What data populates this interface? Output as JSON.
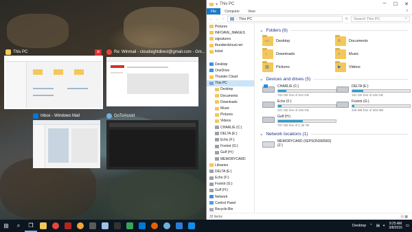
{
  "task_view": {
    "windows": [
      {
        "title": "This PC",
        "selected": true
      },
      {
        "title": "Re: Winmail - cloudsightdirect@gmail.com - Gm..."
      },
      {
        "title": "Inbox - Windows Mail"
      },
      {
        "title": "GoToAssist"
      }
    ]
  },
  "explorer": {
    "title": "This PC",
    "ribbon": {
      "file": "File",
      "tabs": [
        "Computer",
        "View"
      ]
    },
    "address": {
      "path": "This PC",
      "search_placeholder": "Search This PC"
    },
    "nav": [
      {
        "label": "Pictures",
        "type": "folder"
      },
      {
        "label": "INFOAVE_IMAGES",
        "type": "folder"
      },
      {
        "label": "signatures",
        "type": "folder"
      },
      {
        "label": "thunderdcloud.net",
        "type": "folder"
      },
      {
        "label": "ticket",
        "type": "folder"
      },
      {
        "label": "",
        "type": "gap"
      },
      {
        "label": "Desktop",
        "type": "desktop"
      },
      {
        "label": "OneDrive",
        "type": "cloud"
      },
      {
        "label": "Thunder Cloud",
        "type": "folder"
      },
      {
        "label": "This PC",
        "type": "pc",
        "selected": true
      },
      {
        "label": "Desktop",
        "type": "folder",
        "indent": true
      },
      {
        "label": "Documents",
        "type": "folder",
        "indent": true
      },
      {
        "label": "Downloads",
        "type": "folder",
        "indent": true
      },
      {
        "label": "Music",
        "type": "folder",
        "indent": true
      },
      {
        "label": "Pictures",
        "type": "folder",
        "indent": true
      },
      {
        "label": "Videos",
        "type": "folder",
        "indent": true
      },
      {
        "label": "CHARLIE (C:)",
        "type": "drive",
        "indent": true
      },
      {
        "label": "DELTA (E:)",
        "type": "drive",
        "indent": true
      },
      {
        "label": "Echo (F:)",
        "type": "drive",
        "indent": true
      },
      {
        "label": "Foxtrot (G:)",
        "type": "drive",
        "indent": true
      },
      {
        "label": "Gulf (H:)",
        "type": "drive",
        "indent": true
      },
      {
        "label": "MEMORYCARD",
        "type": "drive",
        "indent": true
      },
      {
        "label": "Libraries",
        "type": "folder"
      },
      {
        "label": "DELTA (E:)",
        "type": "drive"
      },
      {
        "label": "Echo (F:)",
        "type": "drive"
      },
      {
        "label": "Foxtrot (G:)",
        "type": "drive"
      },
      {
        "label": "Gulf (H:)",
        "type": "drive"
      },
      {
        "label": "Network",
        "type": "network"
      },
      {
        "label": "Control Panel",
        "type": "cp"
      },
      {
        "label": "Recycle Bin",
        "type": "bin"
      }
    ],
    "folders_header": "Folders (6)",
    "folders": [
      {
        "label": "Desktop",
        "glyph": "▭"
      },
      {
        "label": "Documents",
        "glyph": "≡"
      },
      {
        "label": "Downloads",
        "glyph": "↓"
      },
      {
        "label": "Music",
        "glyph": "♪"
      },
      {
        "label": "Pictures",
        "glyph": "▨"
      },
      {
        "label": "Videos",
        "glyph": "▶"
      }
    ],
    "drives_header": "Devices and drives (5)",
    "drives": [
      {
        "label": "CHARLIE (C:)",
        "free": "783 GB free of 910 GB",
        "used_fraction": 0.14,
        "windows": true
      },
      {
        "label": "DELTA (E:)",
        "free": "191 GB free of 236 GB",
        "used_fraction": 0.19
      },
      {
        "label": "Echo (F:)",
        "free": "221 GB free of 236 GB",
        "used_fraction": 0.06
      },
      {
        "label": "Foxtrot (G:)",
        "free": "348 MB free of 363 MB",
        "used_fraction": 0.04
      },
      {
        "label": "Gulf (H:)",
        "free": "767 GB free of 1.35 TB",
        "used_fraction": 0.43
      }
    ],
    "network_header": "Network locations (1)",
    "network": [
      {
        "label": "MEMORYCARD (\\\\EPSON360583)",
        "sub": "(Z:)"
      }
    ],
    "status": "32 items"
  },
  "taskbar": {
    "desktop_label": "Desktop",
    "time": "9:25 AM",
    "date": "3/8/2016"
  },
  "colors": {
    "accent": "#1979ca",
    "taskbar": "#0c1620",
    "drive_bar": "#26a0da",
    "selection": "#cce4f7"
  }
}
